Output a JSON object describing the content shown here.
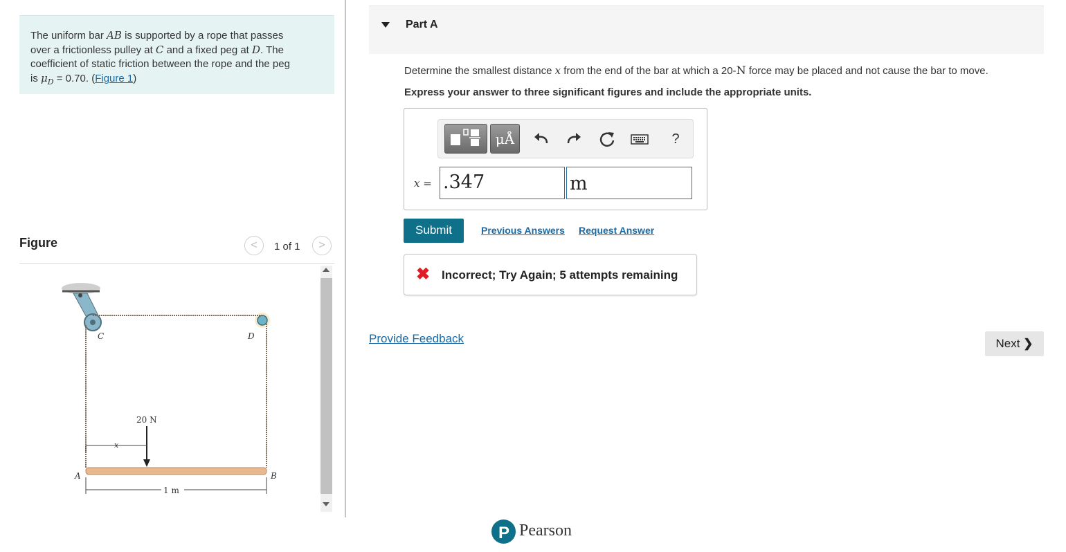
{
  "problem": {
    "line1_pre": "The uniform bar ",
    "line1_var": "AB",
    "line1_post": " is supported by a rope that passes",
    "line2_pre": "over a frictionless pulley at ",
    "line2_var1": "C",
    "line2_mid": " and a fixed peg at ",
    "line2_var2": "D",
    "line2_post": ". The",
    "line3": "coefficient of static friction between the rope and the peg",
    "line4_pre": "is ",
    "line4_var": "μ",
    "line4_sub": "D",
    "line4_post": " = 0.70. (",
    "figure_link": "Figure 1",
    "line4_end": ")"
  },
  "figure_panel": {
    "heading": "Figure",
    "prev_label": "<",
    "next_label": ">",
    "counter": "1 of 1",
    "labels": {
      "A": "A",
      "B": "B",
      "C": "C",
      "D": "D",
      "x": "x",
      "force": "20 N",
      "length": "1 m"
    }
  },
  "part": {
    "title": "Part A",
    "question_pre": "Determine the smallest distance ",
    "question_var": "x",
    "question_mid": " from the end of the bar at which a 20-",
    "question_unit": "N",
    "question_post": " force may be placed and not cause the bar to move.",
    "instruction": "Express your answer to three significant figures and include the appropriate units."
  },
  "answer": {
    "variable_label": "x =",
    "value": ".347",
    "units": "m",
    "toolbar": {
      "templates_icon": "templates-icon",
      "units_label": "μÅ",
      "undo_icon": "undo-icon",
      "redo_icon": "redo-icon",
      "reset_icon": "reset-icon",
      "keyboard_icon": "keyboard-icon",
      "help_label": "?"
    }
  },
  "actions": {
    "submit": "Submit",
    "previous_answers": "Previous Answers",
    "request_answer": "Request Answer"
  },
  "feedback": {
    "icon": "✖",
    "message": "Incorrect; Try Again; 5 attempts remaining"
  },
  "footer": {
    "provide_feedback": "Provide Feedback",
    "next": "Next",
    "next_icon": "❯",
    "brand_letter": "P",
    "brand": "Pearson"
  },
  "colors": {
    "accent": "#0f7089",
    "link": "#1a6aa5",
    "problem_bg": "#e5f4f3",
    "error": "#e01b24",
    "bar": "#e8b88f"
  }
}
